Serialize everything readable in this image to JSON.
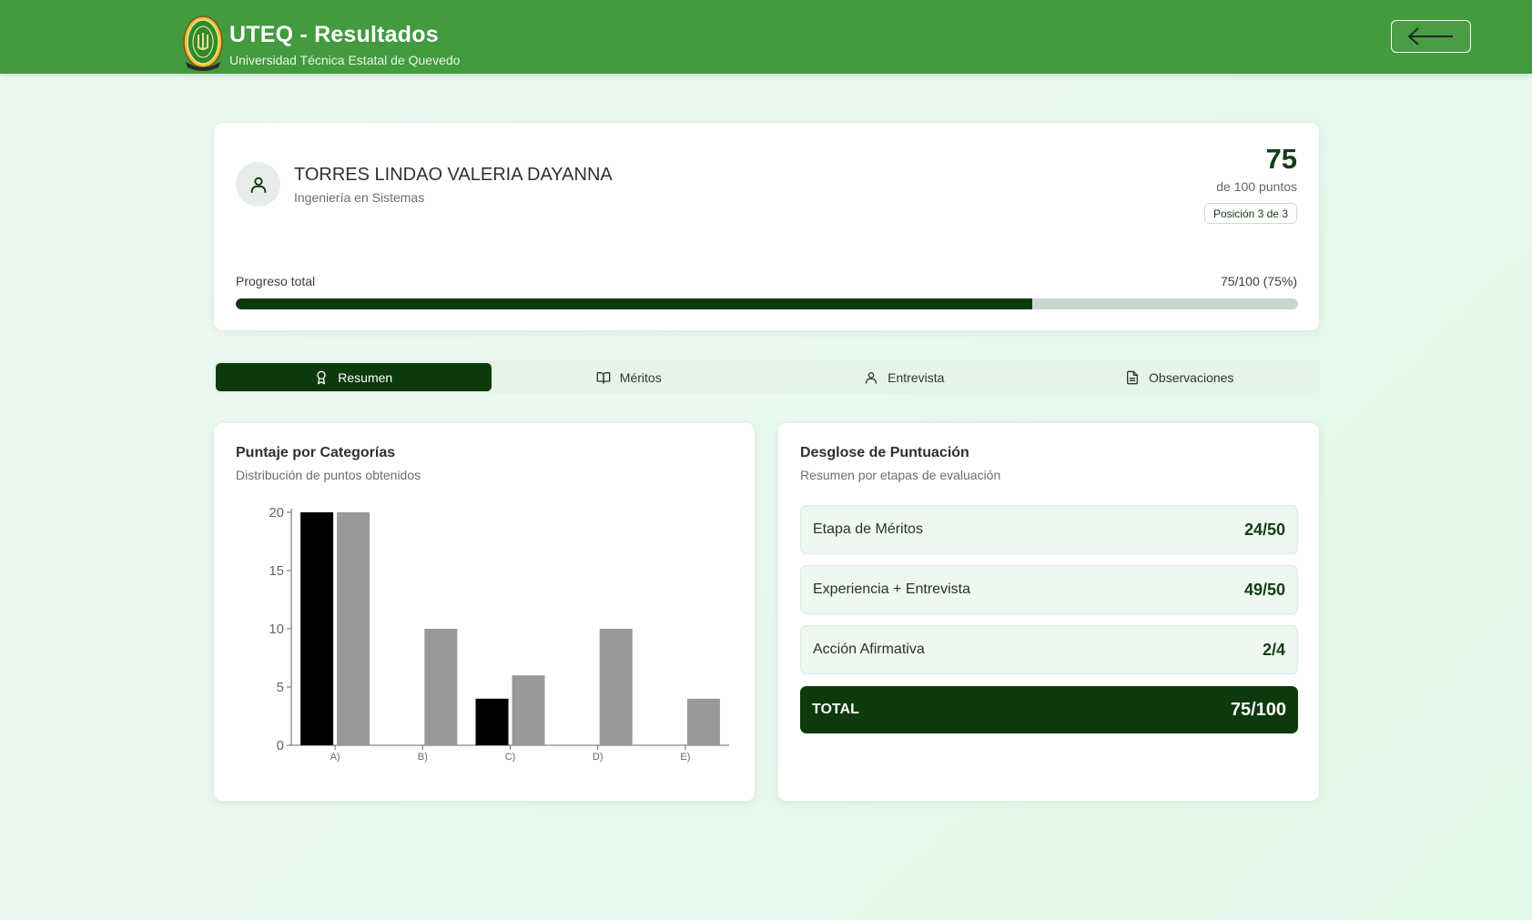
{
  "header": {
    "title": "UTEQ - Resultados",
    "subtitle": "Universidad Técnica Estatal de Quevedo",
    "back_icon": "arrow-left-icon",
    "logo_icon": "university-seal-icon"
  },
  "profile": {
    "name": "TORRES LINDAO VALERIA DAYANNA",
    "career": "Ingeniería en Sistemas",
    "score": "75",
    "score_of": "de 100 puntos",
    "rank": "Posición 3 de 3",
    "progress_label": "Progreso total",
    "progress_text": "75/100 (75%)",
    "progress_fraction": 0.75,
    "avatar_icon": "user-icon"
  },
  "tabs": [
    {
      "label": "Resumen",
      "icon": "award-icon",
      "active": true
    },
    {
      "label": "Méritos",
      "icon": "book-open-icon",
      "active": false
    },
    {
      "label": "Entrevista",
      "icon": "user-icon",
      "active": false
    },
    {
      "label": "Observaciones",
      "icon": "file-text-icon",
      "active": false
    }
  ],
  "chart_card": {
    "title": "Puntaje por Categorías",
    "subtitle": "Distribución de puntos obtenidos"
  },
  "chart_data": {
    "type": "bar",
    "categories": [
      "A)",
      "B)",
      "C)",
      "D)",
      "E)"
    ],
    "series": [
      {
        "values": [
          20,
          0,
          4,
          0,
          0
        ],
        "color": "#000000"
      },
      {
        "values": [
          20,
          10,
          6,
          10,
          4
        ],
        "color": "#999999"
      }
    ],
    "ylim": [
      0,
      20
    ],
    "yticks": [
      0,
      5,
      10,
      15,
      20
    ],
    "grid": false,
    "xlabel": "",
    "ylabel": ""
  },
  "breakdown": {
    "title": "Desglose de Puntuación",
    "subtitle": "Resumen por etapas de evaluación",
    "rows": [
      {
        "label": "Etapa de Méritos",
        "value": "24/50"
      },
      {
        "label": "Experiencia + Entrevista",
        "value": "49/50"
      },
      {
        "label": "Acción Afirmativa",
        "value": "2/4"
      }
    ],
    "total_label": "TOTAL",
    "total_value": "75/100"
  },
  "colors": {
    "header_bg": "#439a3f",
    "primary_dark": "#0c3a0d",
    "page_bg": "#e7f8ec"
  }
}
